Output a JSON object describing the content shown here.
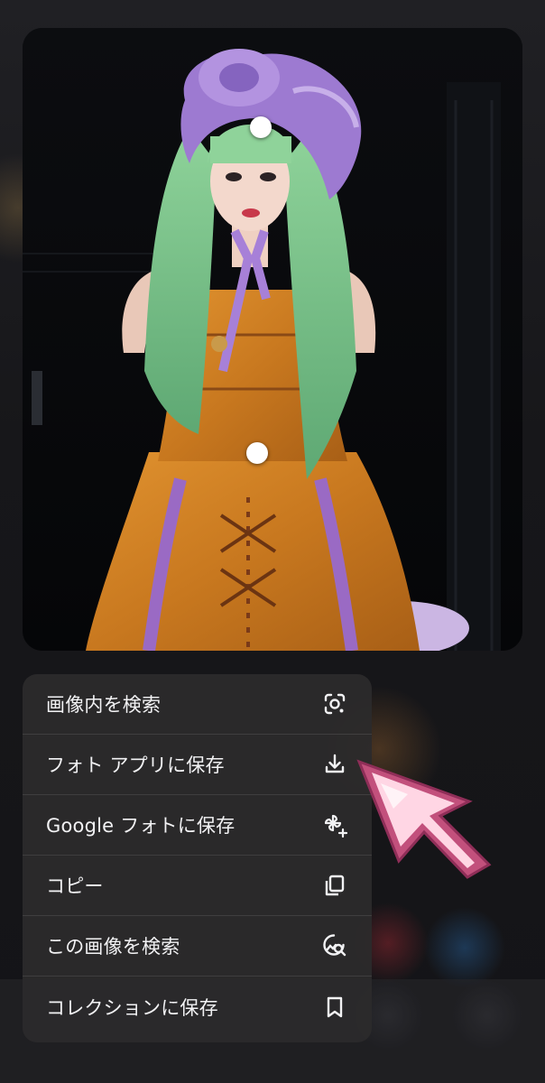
{
  "menu": {
    "items": [
      {
        "label": "画像内を検索",
        "icon": "lens-search-icon"
      },
      {
        "label": "フォト アプリに保存",
        "icon": "download-icon"
      },
      {
        "label": "Google フォトに保存",
        "icon": "google-photos-add-icon"
      },
      {
        "label": "コピー",
        "icon": "copy-icon"
      },
      {
        "label": "この画像を検索",
        "icon": "image-search-icon"
      },
      {
        "label": "コレクションに保存",
        "icon": "bookmark-icon"
      }
    ]
  },
  "colors": {
    "menu_background": "#2c2a2c",
    "menu_text": "#f2f2f4",
    "cursor_fill": "#ffd6e4",
    "cursor_outline": "#c2507c"
  }
}
